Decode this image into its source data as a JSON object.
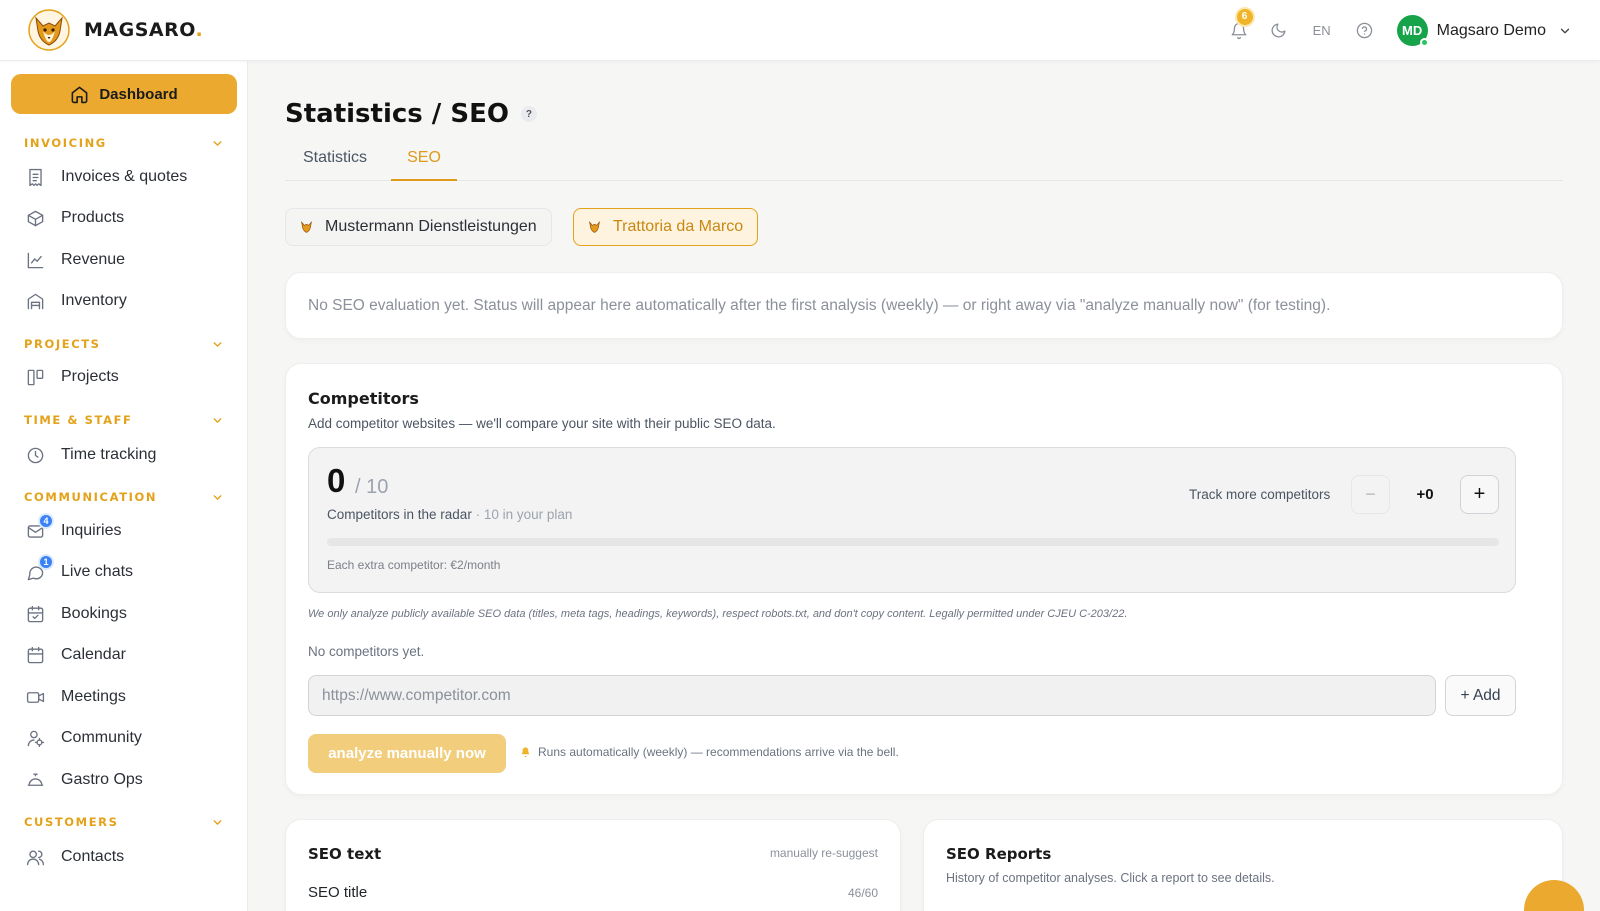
{
  "app": {
    "name": "MAGSARO",
    "name_dot": "."
  },
  "topbar": {
    "notifications_count": "6",
    "language": "EN",
    "user": {
      "initials": "MD",
      "name": "Magsaro Demo"
    },
    "icons": [
      "bell-icon",
      "moon-icon",
      "help-circle-icon",
      "chevron-down-icon"
    ]
  },
  "sidebar": {
    "dashboard_label": "Dashboard",
    "sections": [
      {
        "title": "INVOICING",
        "items": [
          {
            "label": "Invoices & quotes",
            "icon": "receipt-icon"
          },
          {
            "label": "Products",
            "icon": "box-icon"
          },
          {
            "label": "Revenue",
            "icon": "chart-line-icon"
          },
          {
            "label": "Inventory",
            "icon": "warehouse-icon"
          }
        ]
      },
      {
        "title": "PROJECTS",
        "items": [
          {
            "label": "Projects",
            "icon": "kanban-icon"
          }
        ]
      },
      {
        "title": "TIME & STAFF",
        "items": [
          {
            "label": "Time tracking",
            "icon": "clock-icon"
          }
        ]
      },
      {
        "title": "COMMUNICATION",
        "items": [
          {
            "label": "Inquiries",
            "icon": "mail-icon",
            "badge": "4"
          },
          {
            "label": "Live chats",
            "icon": "chat-icon",
            "badge": "1"
          },
          {
            "label": "Bookings",
            "icon": "calendar-check-icon"
          },
          {
            "label": "Calendar",
            "icon": "calendar-icon"
          },
          {
            "label": "Meetings",
            "icon": "video-icon"
          },
          {
            "label": "Community",
            "icon": "community-icon"
          },
          {
            "label": "Gastro Ops",
            "icon": "cloche-icon"
          }
        ]
      },
      {
        "title": "CUSTOMERS",
        "items": [
          {
            "label": "Contacts",
            "icon": "users-icon"
          }
        ]
      }
    ]
  },
  "page": {
    "title": "Statistics / SEO",
    "help": "?",
    "tabs": [
      {
        "label": "Statistics",
        "active": false
      },
      {
        "label": "SEO",
        "active": true
      }
    ],
    "businesses": [
      {
        "label": "Mustermann Dienstleistungen",
        "active": false
      },
      {
        "label": "Trattoria da Marco",
        "active": true
      }
    ],
    "status_message": "No SEO evaluation yet. Status will appear here automatically after the first analysis (weekly) — or right away via \"analyze manually now\" (for testing).",
    "competitors": {
      "title": "Competitors",
      "subtitle": "Add competitor websites — we'll compare your site with their public SEO data.",
      "count": "0",
      "limit": "/ 10",
      "radar_label": "Competitors in the radar",
      "plan_note": " · 10 in your plan",
      "progress_fraction": 0,
      "extra_cost": "Each extra competitor: €2/month",
      "track_more_label": "Track more competitors",
      "minus": "−",
      "extra_value": "+0",
      "plus": "+",
      "legal_note": "We only analyze publicly available SEO data (titles, meta tags, headings, keywords), respect robots.txt, and don't copy content. Legally permitted under CJEU C-203/22.",
      "empty_text": "No competitors yet.",
      "url_placeholder": "https://www.competitor.com",
      "add_label": "+ Add",
      "analyze_label": "analyze manually now",
      "auto_note": "Runs automatically (weekly) — recommendations arrive via the bell."
    },
    "seo_text": {
      "title": "SEO text",
      "re_suggest": "manually re-suggest",
      "field_label": "SEO title",
      "field_count": "46/60"
    },
    "seo_reports": {
      "title": "SEO Reports",
      "subtitle": "History of competitor analyses. Click a report to see details."
    }
  },
  "colors": {
    "accent": "#ebaa2f",
    "accent_text": "#dd9a1b",
    "avatar": "#16a34a",
    "badge_blue": "#3b82f6"
  }
}
